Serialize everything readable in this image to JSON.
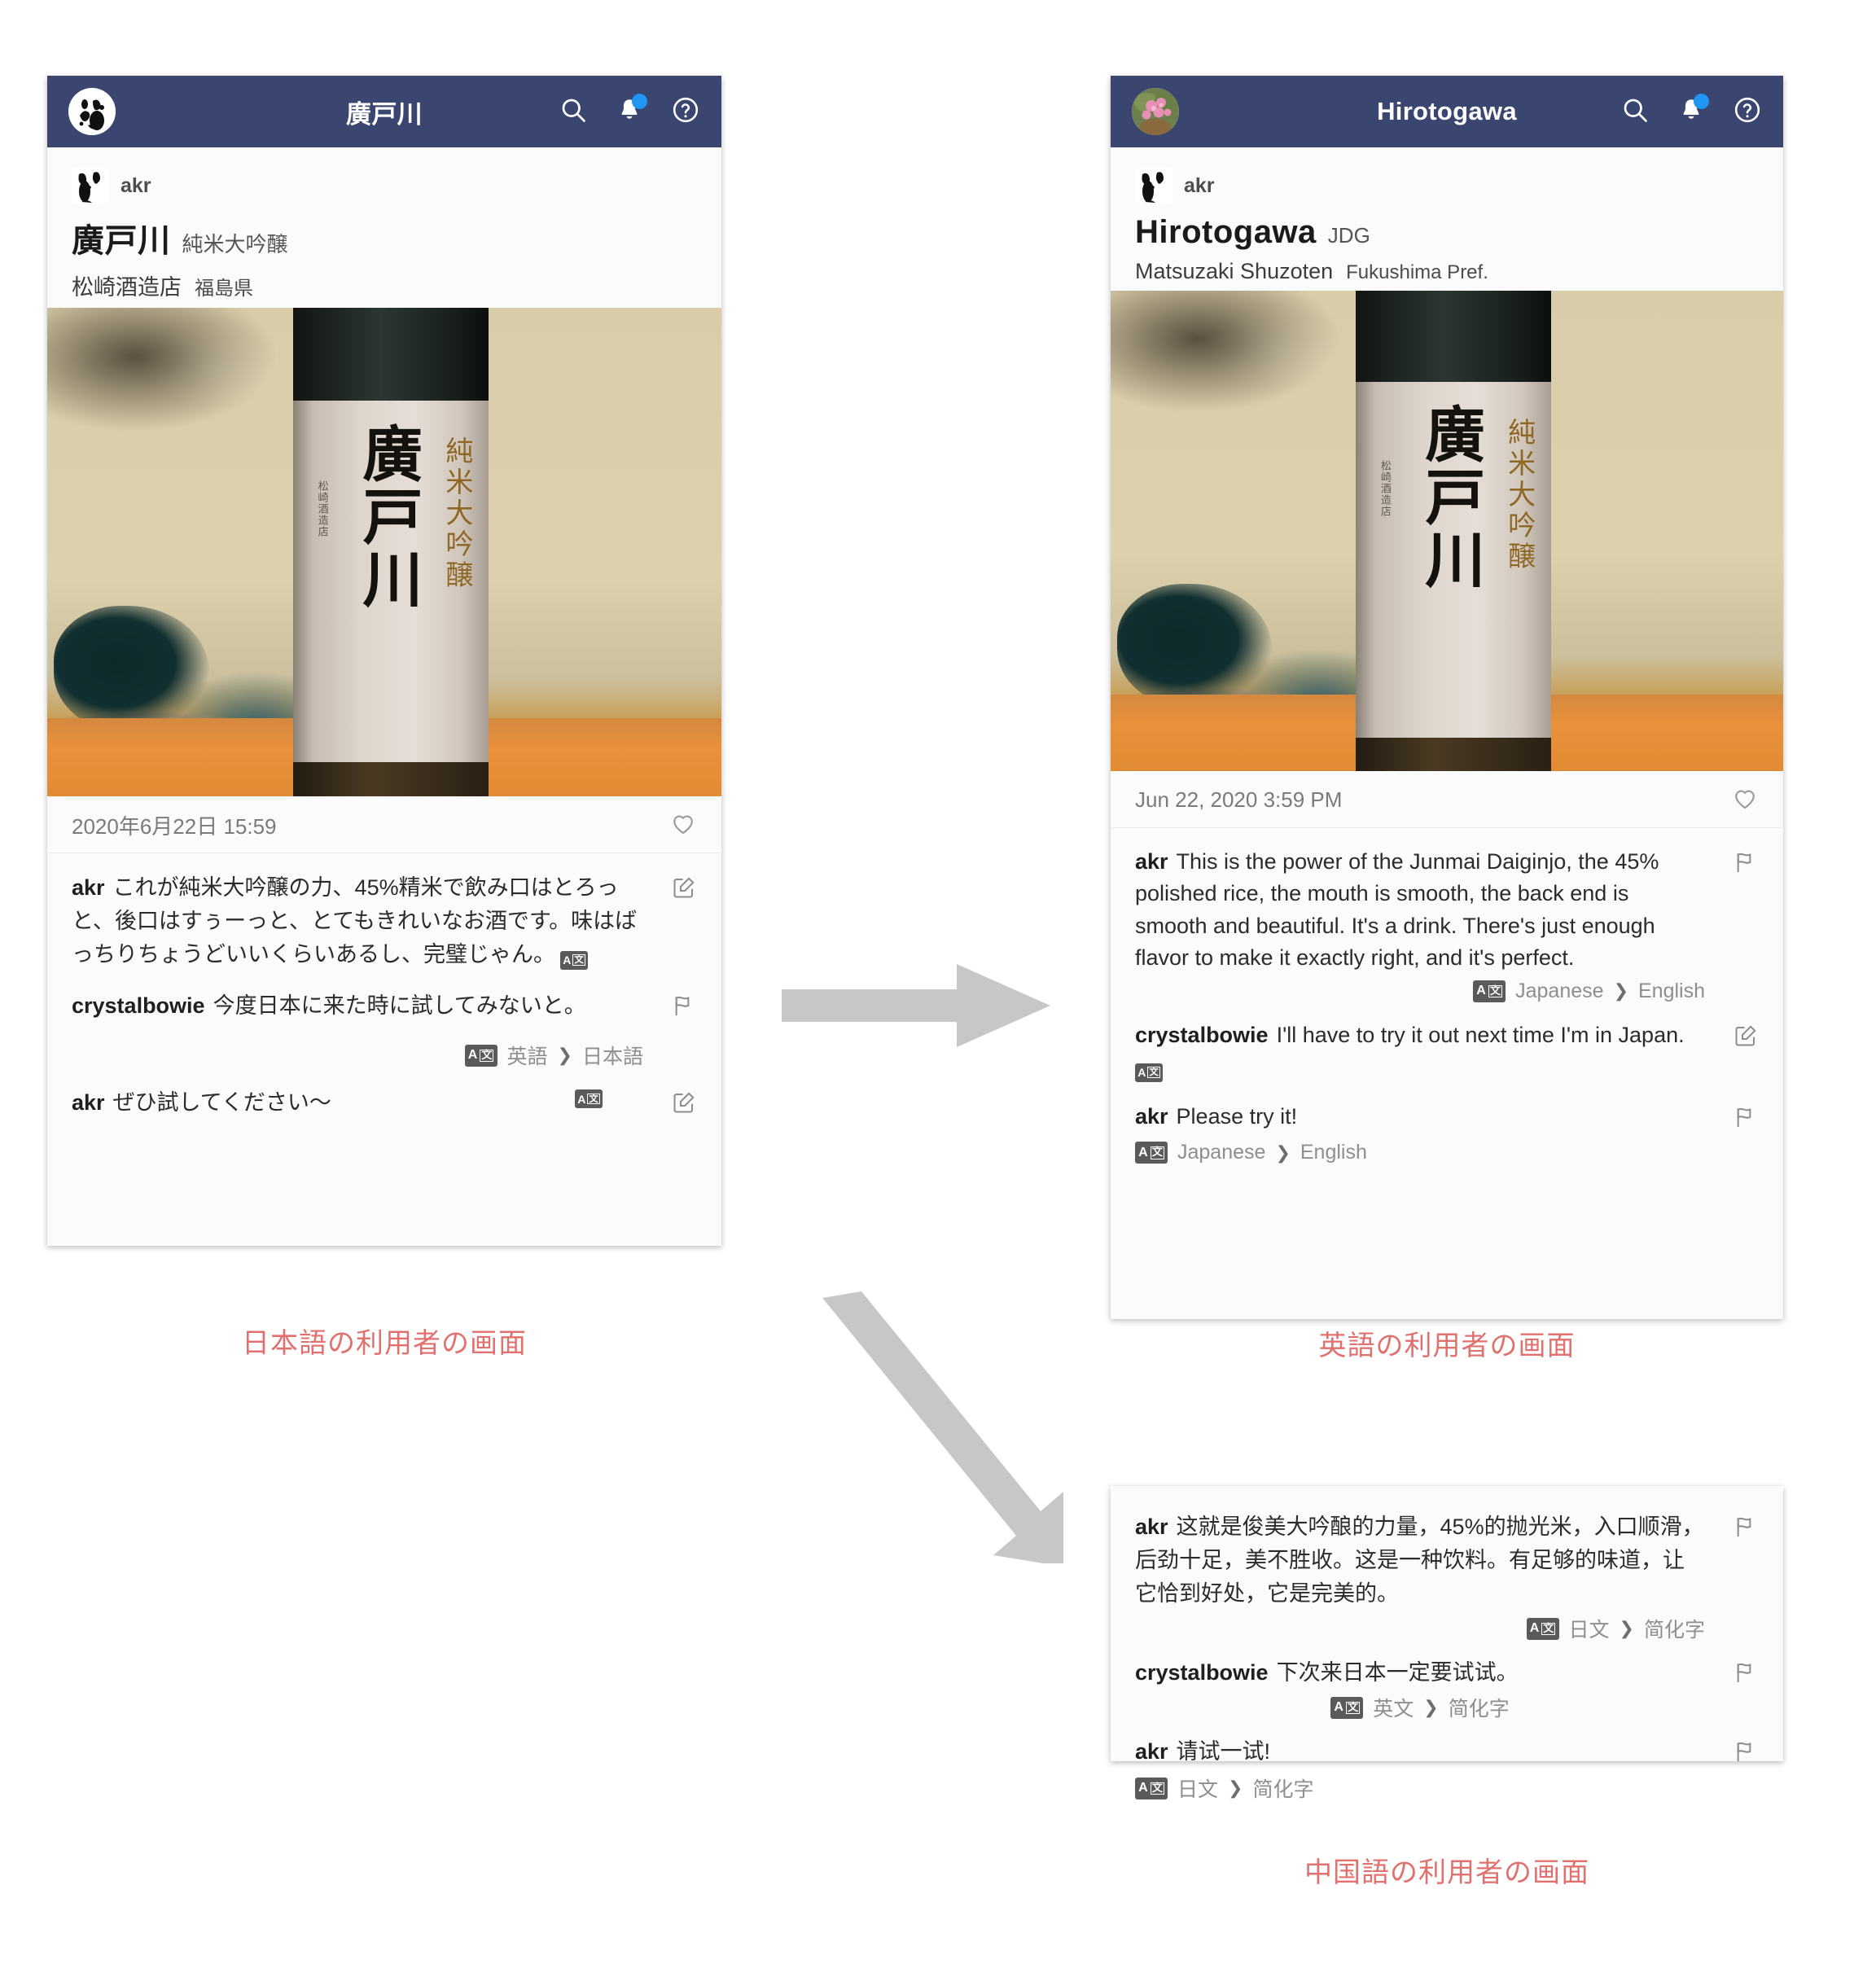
{
  "panels": {
    "japanese": {
      "appbar": {
        "title": "廣戸川",
        "avatar_name": "user-avatar-dog",
        "search_icon": "search-icon",
        "bell_icon": "bell-icon",
        "help_icon": "help-icon"
      },
      "post": {
        "user": "akr",
        "sake_name": "廣戸川",
        "sake_grade": "純米大吟醸",
        "brewery": "松崎酒造店",
        "prefecture": "福島県",
        "date": "2020年6月22日 15:59"
      },
      "comments": [
        {
          "user": "akr",
          "text": "これが純米大吟醸の力、45%精米で飲み口はとろっと、後口はすぅーっと、とてもきれいなお酒です。味はばっちりちょうどいいくらいあるし、完璧じゃん。",
          "inline_badge": true,
          "action_icon": "edit-icon"
        },
        {
          "user": "crystalbowie",
          "text": "今度日本に来た時に試してみないと。",
          "inline_badge": false,
          "action_icon": "flag-icon",
          "lang_from": "英語",
          "lang_to": "日本語",
          "lang_align": "right"
        },
        {
          "user": "akr",
          "text": "ぜひ試してください〜",
          "inline_badge": true,
          "action_icon": "edit-icon"
        }
      ],
      "caption": "日本語の利用者の画面"
    },
    "english": {
      "appbar": {
        "title": "Hirotogawa",
        "avatar_name": "user-avatar-flower",
        "search_icon": "search-icon",
        "bell_icon": "bell-icon",
        "help_icon": "help-icon"
      },
      "post": {
        "user": "akr",
        "sake_name": "Hirotogawa",
        "sake_grade": "JDG",
        "brewery": "Matsuzaki Shuzoten",
        "prefecture": "Fukushima Pref.",
        "date": "Jun 22, 2020 3:59 PM"
      },
      "comments": [
        {
          "user": "akr",
          "text": "This is the power of the Junmai Daiginjo, the 45% polished rice, the mouth is smooth, the back end is smooth and beautiful. It's a drink. There's just enough flavor to make it exactly right, and it's perfect.",
          "inline_badge": false,
          "action_icon": "flag-icon",
          "lang_from": "Japanese",
          "lang_to": "English",
          "lang_align": "right"
        },
        {
          "user": "crystalbowie",
          "text": "I'll have to try it out next time I'm in Japan.",
          "inline_badge": true,
          "action_icon": "edit-icon"
        },
        {
          "user": "akr",
          "text": "Please try it!",
          "inline_badge": false,
          "action_icon": "flag-icon",
          "lang_from": "Japanese",
          "lang_to": "English",
          "lang_align": "left"
        }
      ],
      "caption": "英語の利用者の画面"
    },
    "chinese": {
      "comments": [
        {
          "user": "akr",
          "text": "这就是俊美大吟酿的力量，45%的抛光米，入口顺滑，后劲十足，美不胜收。这是一种饮料。有足够的味道，让它恰到好处，它是完美的。",
          "inline_badge": false,
          "action_icon": "flag-icon",
          "lang_from": "日文",
          "lang_to": "简化字",
          "lang_align": "right"
        },
        {
          "user": "crystalbowie",
          "text": "下次来日本一定要试试。",
          "inline_badge": false,
          "action_icon": "flag-icon",
          "lang_from": "英文",
          "lang_to": "简化字",
          "lang_align": "center"
        },
        {
          "user": "akr",
          "text": "请试一试!",
          "inline_badge": false,
          "action_icon": "flag-icon",
          "lang_from": "日文",
          "lang_to": "简化字",
          "lang_align": "left"
        }
      ],
      "caption": "中国語の利用者の画面"
    }
  },
  "icons": {
    "translate_badge_a": "A",
    "translate_badge_w": "文",
    "chevron": "❯",
    "heart": "heart-icon",
    "edit": "edit-icon",
    "flag": "flag-icon"
  },
  "arrows": {
    "horizontal": "arrow-right",
    "diagonal": "arrow-down-right"
  },
  "colors": {
    "appbar": "#3a4670",
    "accent_blue": "#2196f3",
    "caption_red": "#e0716f",
    "arrow_gray": "#c7c7c7"
  }
}
